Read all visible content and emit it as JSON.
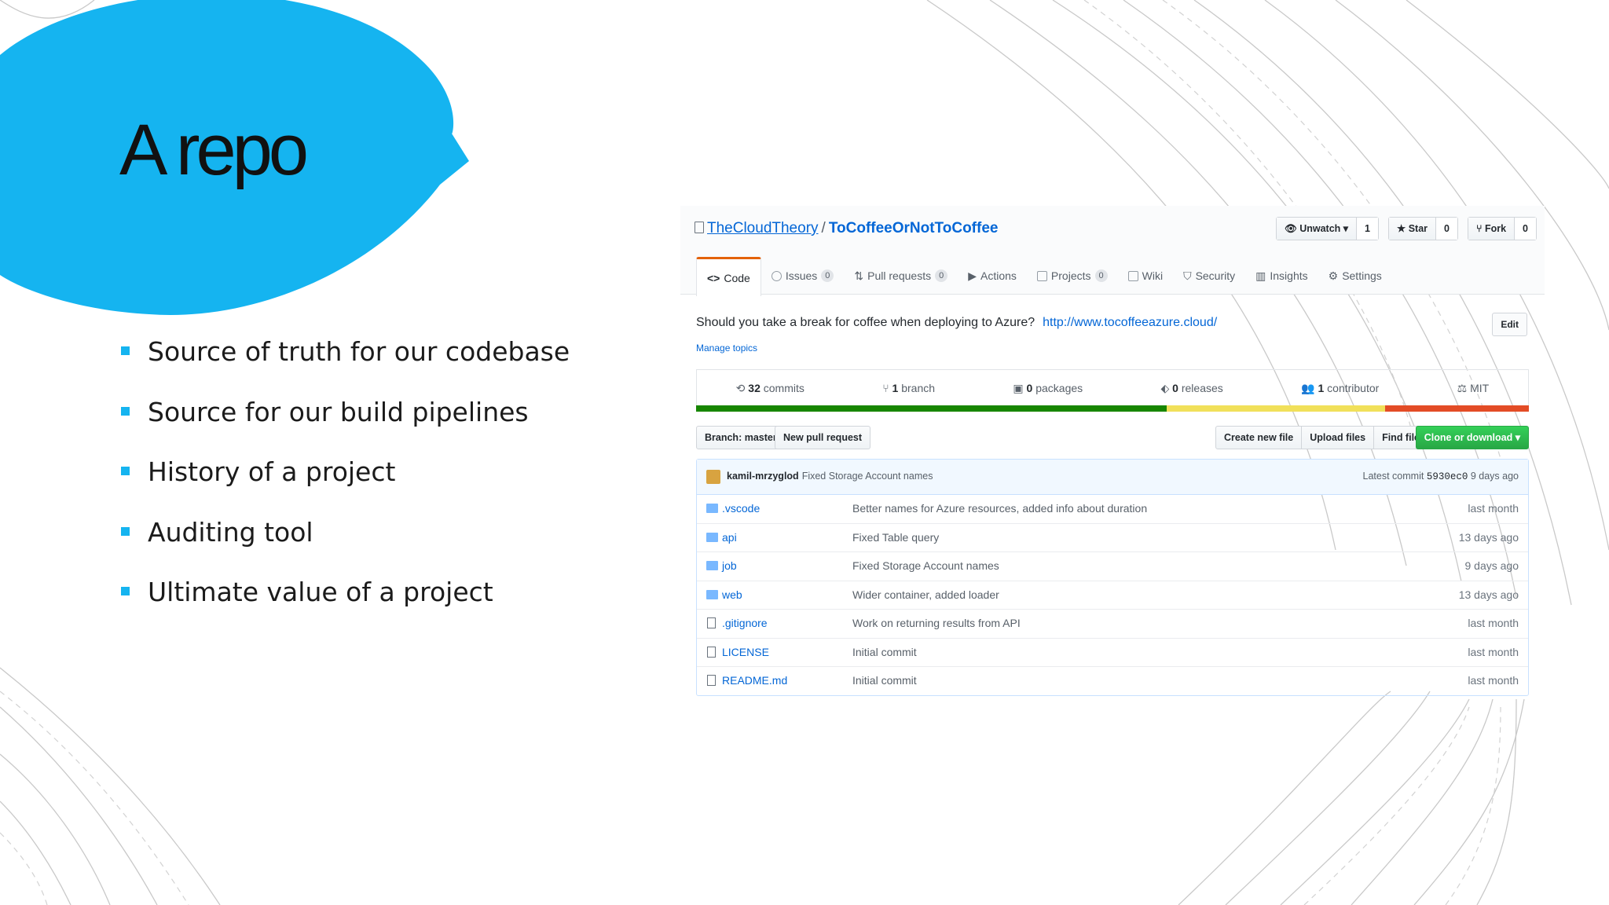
{
  "slide": {
    "title": "A repo",
    "bullets": [
      "Source of truth for our codebase",
      "Source for our build pipelines",
      "History of a project",
      "Auditing tool",
      "Ultimate value of a project"
    ],
    "accent_color": "#15B4F0"
  },
  "repo": {
    "owner": "TheCloudTheory",
    "separator": "/",
    "name": "ToCoffeeOrNotToCoffee",
    "buttons": [
      {
        "icon": "eye-icon",
        "label": "Unwatch ▾",
        "count": "1"
      },
      {
        "icon": "star-icon",
        "label": "Star",
        "count": "0"
      },
      {
        "icon": "fork-icon",
        "label": "Fork",
        "count": "0"
      }
    ],
    "tabs": [
      {
        "label": "Code",
        "count": null
      },
      {
        "label": "Issues",
        "count": "0"
      },
      {
        "label": "Pull requests",
        "count": "0"
      },
      {
        "label": "Actions",
        "count": null
      },
      {
        "label": "Projects",
        "count": "0"
      },
      {
        "label": "Wiki",
        "count": null
      },
      {
        "label": "Security",
        "count": null
      },
      {
        "label": "Insights",
        "count": null
      },
      {
        "label": "Settings",
        "count": null
      }
    ],
    "description": "Should you take a break for coffee when deploying to Azure?",
    "website": "http://www.tocoffeeazure.cloud/",
    "edit_label": "Edit",
    "manage_topics": "Manage topics",
    "summary": [
      {
        "icon": "history-icon",
        "num": "32",
        "label": "commits"
      },
      {
        "icon": "branch-icon",
        "num": "1",
        "label": "branch"
      },
      {
        "icon": "package-icon",
        "num": "0",
        "label": "packages"
      },
      {
        "icon": "tag-icon",
        "num": "0",
        "label": "releases"
      },
      {
        "icon": "people-icon",
        "num": "1",
        "label": "contributor"
      },
      {
        "icon": "law-icon",
        "num": "",
        "label": "MIT"
      }
    ],
    "language_bar": [
      {
        "color": "#178600",
        "share": 0.565
      },
      {
        "color": "#F1E05A",
        "share": 0.262
      },
      {
        "color": "#E34C26",
        "share": 0.173
      }
    ],
    "toolbar": {
      "branch": "Branch: master ▾",
      "new_pr": "New pull request",
      "create_file": "Create new file",
      "upload": "Upload files",
      "find": "Find file",
      "clone": "Clone or download ▾"
    },
    "latest_commit": {
      "author": "kamil-mrzyglod",
      "message": "Fixed Storage Account names",
      "prefix": "Latest commit",
      "sha": "5930ec0",
      "age": "9 days ago"
    },
    "files": [
      {
        "type": "dir",
        "name": ".vscode",
        "message": "Better names for Azure resources, added info about duration",
        "age": "last month"
      },
      {
        "type": "dir",
        "name": "api",
        "message": "Fixed Table query",
        "age": "13 days ago"
      },
      {
        "type": "dir",
        "name": "job",
        "message": "Fixed Storage Account names",
        "age": "9 days ago"
      },
      {
        "type": "dir",
        "name": "web",
        "message": "Wider container, added loader",
        "age": "13 days ago"
      },
      {
        "type": "file",
        "name": ".gitignore",
        "message": "Work on returning results from API",
        "age": "last month"
      },
      {
        "type": "file",
        "name": "LICENSE",
        "message": "Initial commit",
        "age": "last month"
      },
      {
        "type": "file",
        "name": "README.md",
        "message": "Initial commit",
        "age": "last month"
      }
    ]
  }
}
